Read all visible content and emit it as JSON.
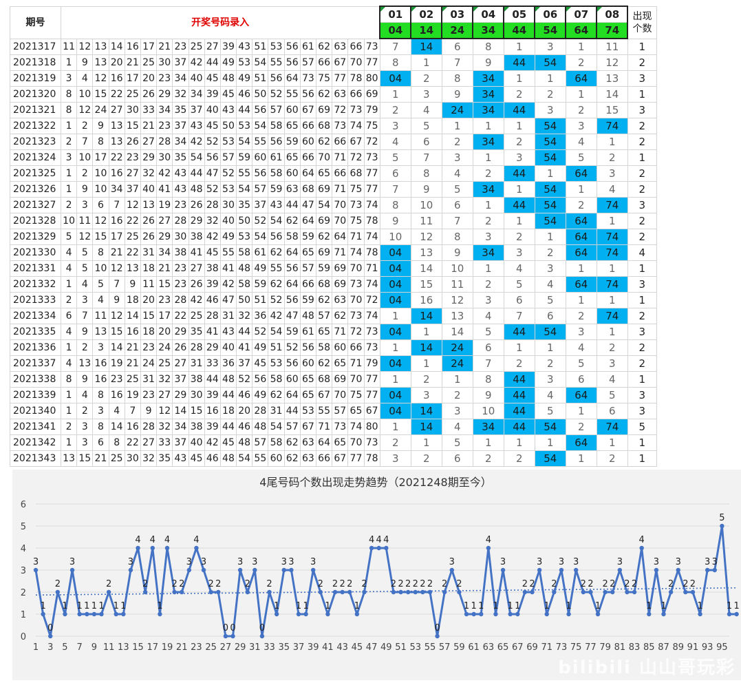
{
  "header": {
    "issue_label": "期号",
    "entry_label": "开奖号码录入",
    "count_label": "出现个数",
    "columns": [
      {
        "top": "01",
        "bot": "04"
      },
      {
        "top": "02",
        "bot": "14"
      },
      {
        "top": "03",
        "bot": "24"
      },
      {
        "top": "04",
        "bot": "34"
      },
      {
        "top": "05",
        "bot": "44"
      },
      {
        "top": "06",
        "bot": "54"
      },
      {
        "top": "07",
        "bot": "64"
      },
      {
        "top": "08",
        "bot": "74"
      }
    ]
  },
  "rows": [
    {
      "issue": "2021317",
      "nums": [
        "11",
        "12",
        "13",
        "14",
        "16",
        "17",
        "21",
        "23",
        "25",
        "27",
        "39",
        "43",
        "51",
        "53",
        "56",
        "61",
        "62",
        "63",
        "66",
        "73"
      ],
      "marks": [
        "7",
        "14",
        "6",
        "8",
        "1",
        "3",
        "1",
        "11"
      ],
      "hits": [
        0,
        1,
        0,
        0,
        0,
        0,
        0,
        0
      ],
      "count": "1"
    },
    {
      "issue": "2021318",
      "nums": [
        "1",
        "9",
        "13",
        "20",
        "21",
        "25",
        "30",
        "37",
        "42",
        "44",
        "49",
        "53",
        "54",
        "55",
        "56",
        "57",
        "66",
        "67",
        "70",
        "77"
      ],
      "marks": [
        "8",
        "1",
        "7",
        "9",
        "44",
        "54",
        "2",
        "12"
      ],
      "hits": [
        0,
        0,
        0,
        0,
        1,
        1,
        0,
        0
      ],
      "count": "2"
    },
    {
      "issue": "2021319",
      "nums": [
        "3",
        "4",
        "12",
        "16",
        "17",
        "20",
        "23",
        "34",
        "40",
        "45",
        "48",
        "49",
        "51",
        "56",
        "64",
        "73",
        "75",
        "77",
        "78",
        "80"
      ],
      "marks": [
        "04",
        "2",
        "8",
        "34",
        "1",
        "1",
        "64",
        "13"
      ],
      "hits": [
        1,
        0,
        0,
        1,
        0,
        0,
        1,
        0
      ],
      "count": "3"
    },
    {
      "issue": "2021320",
      "nums": [
        "8",
        "10",
        "15",
        "22",
        "25",
        "26",
        "29",
        "32",
        "34",
        "39",
        "45",
        "46",
        "50",
        "52",
        "55",
        "56",
        "62",
        "63",
        "66",
        "69"
      ],
      "marks": [
        "1",
        "3",
        "9",
        "34",
        "2",
        "2",
        "1",
        "14"
      ],
      "hits": [
        0,
        0,
        0,
        1,
        0,
        0,
        0,
        0
      ],
      "count": "1"
    },
    {
      "issue": "2021321",
      "nums": [
        "8",
        "12",
        "24",
        "27",
        "30",
        "33",
        "34",
        "35",
        "37",
        "40",
        "43",
        "44",
        "56",
        "57",
        "60",
        "67",
        "69",
        "72",
        "73",
        "79"
      ],
      "marks": [
        "2",
        "4",
        "24",
        "34",
        "44",
        "3",
        "2",
        "15"
      ],
      "hits": [
        0,
        0,
        1,
        1,
        1,
        0,
        0,
        0
      ],
      "count": "3"
    },
    {
      "issue": "2021322",
      "nums": [
        "1",
        "2",
        "9",
        "13",
        "15",
        "21",
        "23",
        "37",
        "43",
        "45",
        "50",
        "53",
        "54",
        "58",
        "65",
        "66",
        "68",
        "73",
        "74",
        "75"
      ],
      "marks": [
        "3",
        "5",
        "1",
        "1",
        "1",
        "54",
        "3",
        "74"
      ],
      "hits": [
        0,
        0,
        0,
        0,
        0,
        1,
        0,
        1
      ],
      "count": "2"
    },
    {
      "issue": "2021323",
      "nums": [
        "2",
        "7",
        "8",
        "13",
        "26",
        "27",
        "28",
        "34",
        "42",
        "52",
        "53",
        "54",
        "55",
        "56",
        "59",
        "60",
        "62",
        "66",
        "67",
        "72"
      ],
      "marks": [
        "4",
        "6",
        "2",
        "34",
        "2",
        "54",
        "4",
        "1"
      ],
      "hits": [
        0,
        0,
        0,
        1,
        0,
        1,
        0,
        0
      ],
      "count": "2"
    },
    {
      "issue": "2021324",
      "nums": [
        "3",
        "10",
        "17",
        "22",
        "23",
        "29",
        "30",
        "35",
        "54",
        "56",
        "57",
        "59",
        "60",
        "61",
        "65",
        "66",
        "70",
        "71",
        "72",
        "73"
      ],
      "marks": [
        "5",
        "7",
        "3",
        "1",
        "3",
        "54",
        "5",
        "2"
      ],
      "hits": [
        0,
        0,
        0,
        0,
        0,
        1,
        0,
        0
      ],
      "count": "1"
    },
    {
      "issue": "2021325",
      "nums": [
        "1",
        "2",
        "10",
        "16",
        "27",
        "32",
        "42",
        "43",
        "44",
        "47",
        "52",
        "55",
        "56",
        "58",
        "60",
        "64",
        "65",
        "66",
        "68",
        "77"
      ],
      "marks": [
        "6",
        "8",
        "4",
        "2",
        "44",
        "1",
        "64",
        "3"
      ],
      "hits": [
        0,
        0,
        0,
        0,
        1,
        0,
        1,
        0
      ],
      "count": "2"
    },
    {
      "issue": "2021326",
      "nums": [
        "1",
        "9",
        "10",
        "34",
        "37",
        "40",
        "41",
        "43",
        "48",
        "52",
        "53",
        "54",
        "57",
        "59",
        "63",
        "68",
        "69",
        "71",
        "75",
        "77"
      ],
      "marks": [
        "7",
        "9",
        "5",
        "34",
        "1",
        "54",
        "1",
        "4"
      ],
      "hits": [
        0,
        0,
        0,
        1,
        0,
        1,
        0,
        0
      ],
      "count": "2"
    },
    {
      "issue": "2021327",
      "nums": [
        "2",
        "3",
        "6",
        "7",
        "12",
        "13",
        "19",
        "23",
        "26",
        "28",
        "30",
        "35",
        "37",
        "43",
        "44",
        "47",
        "54",
        "70",
        "73",
        "74"
      ],
      "marks": [
        "8",
        "10",
        "6",
        "1",
        "44",
        "54",
        "2",
        "74"
      ],
      "hits": [
        0,
        0,
        0,
        0,
        1,
        1,
        0,
        1
      ],
      "count": "3"
    },
    {
      "issue": "2021328",
      "nums": [
        "10",
        "11",
        "12",
        "16",
        "22",
        "26",
        "27",
        "28",
        "29",
        "32",
        "40",
        "50",
        "52",
        "54",
        "62",
        "64",
        "69",
        "70",
        "75",
        "78"
      ],
      "marks": [
        "9",
        "11",
        "7",
        "2",
        "1",
        "54",
        "64",
        "1"
      ],
      "hits": [
        0,
        0,
        0,
        0,
        0,
        1,
        1,
        0
      ],
      "count": "2"
    },
    {
      "issue": "2021329",
      "nums": [
        "5",
        "12",
        "15",
        "17",
        "25",
        "26",
        "29",
        "30",
        "38",
        "42",
        "49",
        "53",
        "54",
        "56",
        "58",
        "59",
        "62",
        "64",
        "71",
        "74",
        "77"
      ],
      "marks": [
        "10",
        "12",
        "8",
        "3",
        "2",
        "1",
        "64",
        "74"
      ],
      "hits": [
        0,
        0,
        0,
        0,
        0,
        0,
        1,
        1
      ],
      "count": "2"
    },
    {
      "issue": "2021330",
      "nums": [
        "4",
        "5",
        "8",
        "21",
        "22",
        "31",
        "34",
        "38",
        "41",
        "45",
        "55",
        "58",
        "61",
        "62",
        "64",
        "65",
        "69",
        "71",
        "74",
        "78"
      ],
      "marks": [
        "04",
        "13",
        "9",
        "34",
        "3",
        "2",
        "64",
        "74"
      ],
      "hits": [
        1,
        0,
        0,
        1,
        0,
        0,
        1,
        1
      ],
      "count": "4"
    },
    {
      "issue": "2021331",
      "nums": [
        "4",
        "5",
        "10",
        "12",
        "13",
        "18",
        "21",
        "23",
        "27",
        "38",
        "41",
        "48",
        "49",
        "55",
        "56",
        "57",
        "59",
        "69",
        "70",
        "71"
      ],
      "marks": [
        "04",
        "14",
        "10",
        "1",
        "4",
        "3",
        "1",
        "1"
      ],
      "hits": [
        1,
        0,
        0,
        0,
        0,
        0,
        0,
        0
      ],
      "count": "1"
    },
    {
      "issue": "2021332",
      "nums": [
        "1",
        "4",
        "5",
        "7",
        "9",
        "11",
        "15",
        "23",
        "26",
        "39",
        "42",
        "58",
        "59",
        "62",
        "64",
        "66",
        "68",
        "69",
        "73",
        "74"
      ],
      "marks": [
        "04",
        "15",
        "11",
        "2",
        "5",
        "4",
        "64",
        "74"
      ],
      "hits": [
        1,
        0,
        0,
        0,
        0,
        0,
        1,
        1
      ],
      "count": "3"
    },
    {
      "issue": "2021333",
      "nums": [
        "2",
        "3",
        "4",
        "9",
        "18",
        "20",
        "23",
        "28",
        "42",
        "46",
        "47",
        "50",
        "51",
        "52",
        "56",
        "59",
        "62",
        "63",
        "70",
        "72"
      ],
      "marks": [
        "04",
        "16",
        "12",
        "3",
        "6",
        "5",
        "1",
        "1"
      ],
      "hits": [
        1,
        0,
        0,
        0,
        0,
        0,
        0,
        0
      ],
      "count": "1"
    },
    {
      "issue": "2021334",
      "nums": [
        "6",
        "7",
        "11",
        "12",
        "14",
        "15",
        "17",
        "22",
        "25",
        "28",
        "31",
        "32",
        "36",
        "42",
        "47",
        "48",
        "57",
        "62",
        "73",
        "74"
      ],
      "marks": [
        "1",
        "14",
        "13",
        "4",
        "7",
        "6",
        "2",
        "74"
      ],
      "hits": [
        0,
        1,
        0,
        0,
        0,
        0,
        0,
        1
      ],
      "count": "2"
    },
    {
      "issue": "2021335",
      "nums": [
        "4",
        "9",
        "13",
        "15",
        "16",
        "18",
        "20",
        "29",
        "35",
        "41",
        "43",
        "44",
        "52",
        "54",
        "59",
        "61",
        "65",
        "71",
        "72",
        "73"
      ],
      "marks": [
        "04",
        "1",
        "14",
        "5",
        "44",
        "54",
        "3",
        "1"
      ],
      "hits": [
        1,
        0,
        0,
        0,
        1,
        1,
        0,
        0
      ],
      "count": "3"
    },
    {
      "issue": "2021336",
      "nums": [
        "1",
        "2",
        "3",
        "14",
        "21",
        "23",
        "24",
        "26",
        "28",
        "29",
        "40",
        "41",
        "49",
        "51",
        "52",
        "56",
        "58",
        "60",
        "66",
        "73"
      ],
      "marks": [
        "1",
        "14",
        "24",
        "6",
        "1",
        "1",
        "4",
        "2"
      ],
      "hits": [
        0,
        1,
        1,
        0,
        0,
        0,
        0,
        0
      ],
      "count": "2"
    },
    {
      "issue": "2021337",
      "nums": [
        "4",
        "13",
        "16",
        "19",
        "21",
        "24",
        "25",
        "27",
        "31",
        "33",
        "36",
        "37",
        "45",
        "53",
        "56",
        "60",
        "62",
        "65",
        "71",
        "79"
      ],
      "marks": [
        "04",
        "1",
        "24",
        "7",
        "2",
        "2",
        "5",
        "3"
      ],
      "hits": [
        1,
        0,
        1,
        0,
        0,
        0,
        0,
        0
      ],
      "count": "2"
    },
    {
      "issue": "2021338",
      "nums": [
        "8",
        "9",
        "16",
        "23",
        "25",
        "31",
        "32",
        "37",
        "38",
        "44",
        "48",
        "52",
        "56",
        "58",
        "60",
        "65",
        "68",
        "69",
        "70",
        "77"
      ],
      "marks": [
        "1",
        "2",
        "1",
        "8",
        "44",
        "3",
        "6",
        "4"
      ],
      "hits": [
        0,
        0,
        0,
        0,
        1,
        0,
        0,
        0
      ],
      "count": "1"
    },
    {
      "issue": "2021339",
      "nums": [
        "1",
        "4",
        "8",
        "16",
        "19",
        "23",
        "27",
        "29",
        "30",
        "39",
        "44",
        "46",
        "49",
        "62",
        "64",
        "65",
        "67",
        "70",
        "75",
        "77"
      ],
      "marks": [
        "04",
        "3",
        "2",
        "9",
        "44",
        "4",
        "64",
        "5"
      ],
      "hits": [
        1,
        0,
        0,
        0,
        1,
        0,
        1,
        0
      ],
      "count": "3"
    },
    {
      "issue": "2021340",
      "nums": [
        "1",
        "2",
        "3",
        "4",
        "7",
        "9",
        "12",
        "14",
        "15",
        "16",
        "18",
        "20",
        "28",
        "31",
        "44",
        "53",
        "55",
        "57",
        "65",
        "67"
      ],
      "marks": [
        "04",
        "14",
        "3",
        "10",
        "44",
        "5",
        "1",
        "6"
      ],
      "hits": [
        1,
        1,
        0,
        0,
        1,
        0,
        0,
        0
      ],
      "count": "3"
    },
    {
      "issue": "2021341",
      "nums": [
        "2",
        "3",
        "8",
        "14",
        "16",
        "28",
        "32",
        "34",
        "38",
        "39",
        "44",
        "46",
        "48",
        "54",
        "57",
        "67",
        "71",
        "73",
        "74",
        "80"
      ],
      "marks": [
        "1",
        "14",
        "4",
        "34",
        "44",
        "54",
        "2",
        "74"
      ],
      "hits": [
        0,
        1,
        0,
        1,
        1,
        1,
        0,
        1
      ],
      "count": "5"
    },
    {
      "issue": "2021342",
      "nums": [
        "1",
        "3",
        "6",
        "8",
        "22",
        "27",
        "33",
        "37",
        "40",
        "42",
        "45",
        "48",
        "57",
        "58",
        "62",
        "63",
        "64",
        "65",
        "70",
        "73"
      ],
      "marks": [
        "2",
        "1",
        "5",
        "1",
        "1",
        "1",
        "64",
        "1"
      ],
      "hits": [
        0,
        0,
        0,
        0,
        0,
        0,
        1,
        0
      ],
      "count": "1"
    },
    {
      "issue": "2021343",
      "nums": [
        "13",
        "15",
        "21",
        "25",
        "30",
        "32",
        "35",
        "43",
        "45",
        "46",
        "48",
        "54",
        "55",
        "60",
        "62",
        "63",
        "66",
        "67",
        "77",
        "78"
      ],
      "marks": [
        "3",
        "2",
        "6",
        "2",
        "2",
        "54",
        "1",
        "2"
      ],
      "hits": [
        0,
        0,
        0,
        0,
        0,
        1,
        0,
        0
      ],
      "count": "1"
    }
  ],
  "chart_data": {
    "type": "line",
    "title": "4尾号码个数出现走势趋势（2021248期至今）",
    "x_ticks": [
      1,
      3,
      5,
      7,
      9,
      11,
      13,
      15,
      17,
      19,
      21,
      23,
      25,
      27,
      29,
      31,
      33,
      35,
      37,
      39,
      41,
      43,
      45,
      47,
      49,
      51,
      53,
      55,
      57,
      59,
      61,
      63,
      65,
      67,
      69,
      71,
      73,
      75,
      77,
      79,
      81,
      83,
      85,
      87,
      89,
      91,
      93,
      95
    ],
    "y_ticks": [
      0,
      1,
      2,
      3,
      4,
      5,
      6
    ],
    "ylim": [
      0,
      6
    ],
    "xlim": [
      1,
      96
    ],
    "trendline": "linear dotted",
    "color": "#4472c4",
    "values": [
      3,
      1,
      0,
      2,
      1,
      3,
      1,
      1,
      1,
      1,
      2,
      1,
      1,
      3,
      4,
      2,
      4,
      1,
      4,
      2,
      2,
      3,
      4,
      3,
      2,
      2,
      0,
      0,
      3,
      2,
      3,
      0,
      2,
      1,
      3,
      3,
      1,
      1,
      3,
      2,
      1,
      2,
      2,
      2,
      1,
      2,
      4,
      4,
      4,
      2,
      2,
      2,
      2,
      2,
      2,
      0,
      2,
      3,
      2,
      1,
      1,
      1,
      4,
      1,
      3,
      1,
      1,
      2,
      2,
      3,
      1,
      2,
      3,
      1,
      3,
      2,
      2,
      1,
      2,
      2,
      3,
      2,
      2,
      4,
      1,
      3,
      1,
      2,
      3,
      2,
      2,
      1,
      3,
      3,
      5,
      1,
      1
    ]
  },
  "watermark": "bilibili 山山哥玩彩"
}
